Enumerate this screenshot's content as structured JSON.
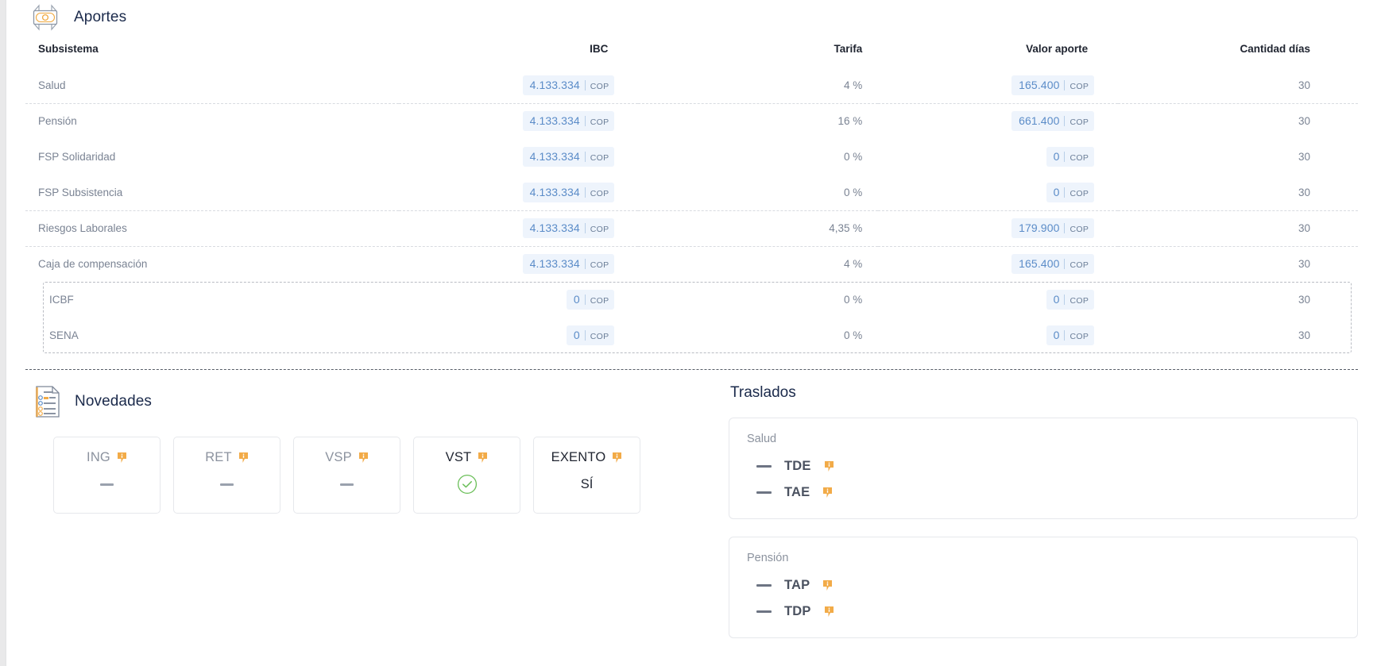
{
  "aportes": {
    "title": "Aportes",
    "icon": "money-banknote-icon",
    "columns": {
      "subsistema": "Subsistema",
      "ibc": "IBC",
      "tarifa": "Tarifa",
      "valor_aporte": "Valor aporte",
      "cantidad_dias": "Cantidad días"
    },
    "currency": "COP",
    "rows": [
      {
        "subsistema": "Salud",
        "ibc": "4.133.334",
        "ibc_cur": "COP",
        "tarifa": "4 %",
        "valor": "165.400",
        "valor_cur": "COP",
        "dias": "30"
      },
      {
        "subsistema": "Pensión",
        "ibc": "4.133.334",
        "ibc_cur": "COP",
        "tarifa": "16 %",
        "valor": "661.400",
        "valor_cur": "COP",
        "dias": "30"
      },
      {
        "subsistema": "FSP Solidaridad",
        "ibc": "4.133.334",
        "ibc_cur": "COP",
        "tarifa": "0 %",
        "valor": "0",
        "valor_cur": "COP",
        "dias": "30"
      },
      {
        "subsistema": "FSP Subsistencia",
        "ibc": "4.133.334",
        "ibc_cur": "COP",
        "tarifa": "0 %",
        "valor": "0",
        "valor_cur": "COP",
        "dias": "30"
      },
      {
        "subsistema": "Riesgos Laborales",
        "ibc": "4.133.334",
        "ibc_cur": "COP",
        "tarifa": "4,35 %",
        "valor": "179.900",
        "valor_cur": "COP",
        "dias": "30"
      },
      {
        "subsistema": "Caja de compensación",
        "ibc": "4.133.334",
        "ibc_cur": "COP",
        "tarifa": "4 %",
        "valor": "165.400",
        "valor_cur": "COP",
        "dias": "30"
      },
      {
        "subsistema": "ICBF",
        "ibc": "0",
        "ibc_cur": "COP",
        "tarifa": "0 %",
        "valor": "0",
        "valor_cur": "COP",
        "dias": "30"
      },
      {
        "subsistema": "SENA",
        "ibc": "0",
        "ibc_cur": "COP",
        "tarifa": "0 %",
        "valor": "0",
        "valor_cur": "COP",
        "dias": "30"
      }
    ]
  },
  "novedades": {
    "title": "Novedades",
    "icon": "document-list-icon",
    "cards": [
      {
        "label": "ING",
        "value": "—",
        "value_kind": "dash",
        "active": false,
        "info_icon": "info-tooltip-icon"
      },
      {
        "label": "RET",
        "value": "—",
        "value_kind": "dash",
        "active": false,
        "info_icon": "info-tooltip-icon"
      },
      {
        "label": "VSP",
        "value": "—",
        "value_kind": "dash",
        "active": false,
        "info_icon": "info-tooltip-icon"
      },
      {
        "label": "VST",
        "value": "",
        "value_kind": "check",
        "active": true,
        "info_icon": "info-tooltip-icon"
      },
      {
        "label": "EXENTO",
        "value": "SÍ",
        "value_kind": "text",
        "active": true,
        "info_icon": "info-tooltip-icon"
      }
    ]
  },
  "traslados": {
    "title": "Traslados",
    "groups": [
      {
        "name": "Salud",
        "items": [
          {
            "mark": "—",
            "code": "TDE",
            "info_icon": "info-tooltip-icon"
          },
          {
            "mark": "—",
            "code": "TAE",
            "info_icon": "info-tooltip-icon"
          }
        ]
      },
      {
        "name": "Pensión",
        "items": [
          {
            "mark": "—",
            "code": "TAP",
            "info_icon": "info-tooltip-icon"
          },
          {
            "mark": "—",
            "code": "TDP",
            "info_icon": "info-tooltip-icon"
          }
        ]
      }
    ]
  },
  "colors": {
    "accent_blue": "#5b8cc8",
    "badge_bg": "#eef4fc",
    "title_navy": "#1b2a4b",
    "muted_text": "#7a8393",
    "info_orange": "#f2ab48",
    "success_green": "#6bbf59"
  }
}
